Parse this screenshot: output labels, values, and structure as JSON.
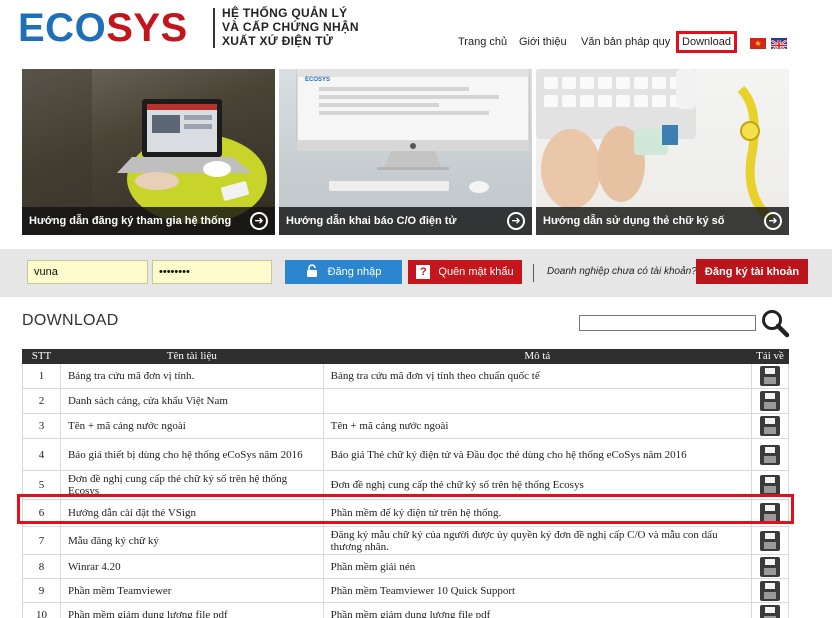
{
  "header": {
    "logo_part1": "ECO",
    "logo_part2": "SYS",
    "tagline": [
      "HỆ THỐNG QUẢN LÝ",
      "VÀ CẤP CHỨNG NHẬN",
      "XUẤT XỨ ĐIỆN TỬ"
    ],
    "nav": [
      {
        "label": "Trang chủ"
      },
      {
        "label": "Giới thiệu"
      },
      {
        "label": "Văn bản pháp quy"
      },
      {
        "label": "Download"
      }
    ],
    "flags": [
      "vietnam-flag-icon",
      "uk-flag-icon"
    ]
  },
  "banners": [
    {
      "caption": "Hướng dẫn đăng ký tham gia hệ thống",
      "icon": "arrow-right-circle-icon"
    },
    {
      "caption": "Hướng dẫn khai báo C/O điện tử",
      "icon": "arrow-right-circle-icon"
    },
    {
      "caption": "Hướng dẫn sử dụng thẻ chữ ký số",
      "icon": "arrow-right-circle-icon"
    }
  ],
  "login": {
    "username": "vuna",
    "password": "••••••••",
    "login_label": "Đăng nhập",
    "forgot_label": "Quên mật khẩu",
    "no_account_text": "Doanh nghiệp chưa có tài khoản?",
    "register_label": "Đăng ký tài khoản"
  },
  "download": {
    "title": "DOWNLOAD",
    "search_value": "",
    "columns": [
      "STT",
      "Tên tài liệu",
      "Mô tả",
      "Tải về"
    ],
    "rows": [
      {
        "stt": "1",
        "name": "Bảng tra cứu mã đơn vị tính.",
        "desc": "Bảng tra cứu mã đơn vị tính theo chuẩn quốc tế"
      },
      {
        "stt": "2",
        "name": "Danh sách cảng, cửa khẩu Việt Nam",
        "desc": ""
      },
      {
        "stt": "3",
        "name": "Tên + mã cảng nước ngoài",
        "desc": "Tên + mã cảng nước ngoài"
      },
      {
        "stt": "4",
        "name": "Báo giá thiết bị dùng cho hệ thống eCoSys năm 2016",
        "desc": "Báo giá Thẻ chữ ký điện tử và Đầu đọc thẻ dùng cho hệ thống eCoSys năm 2016"
      },
      {
        "stt": "5",
        "name": "Đơn đề nghị cung cấp thẻ chữ ký số trên hệ thống Ecosys",
        "desc": "Đơn đề nghị cung cấp thẻ chữ ký số trên hệ thống Ecosys"
      },
      {
        "stt": "6",
        "name": "Hướng dẫn cài đặt thẻ VSign",
        "desc": "Phần mềm để ký điện tử trên hệ thống."
      },
      {
        "stt": "7",
        "name": "Mẫu đăng ký chữ ký",
        "desc": "Đăng ký mẫu chữ ký của người được ủy quyền ký đơn đề nghị cấp C/O và mẫu con dấu thương nhân."
      },
      {
        "stt": "8",
        "name": "Winrar 4.20",
        "desc": "Phần mềm giải nén"
      },
      {
        "stt": "9",
        "name": "Phần mềm Teamviewer",
        "desc": "Phần mềm Teamviewer 10 Quick Support"
      },
      {
        "stt": "10",
        "name": "Phần mềm giảm dung lượng file pdf",
        "desc": "Phần mềm giảm dung lượng file pdf"
      }
    ]
  },
  "colors": {
    "brand_blue": "#1d6fb8",
    "brand_red": "#c3161c",
    "highlight_red": "#e3101b",
    "login_blue": "#2b86cf"
  }
}
